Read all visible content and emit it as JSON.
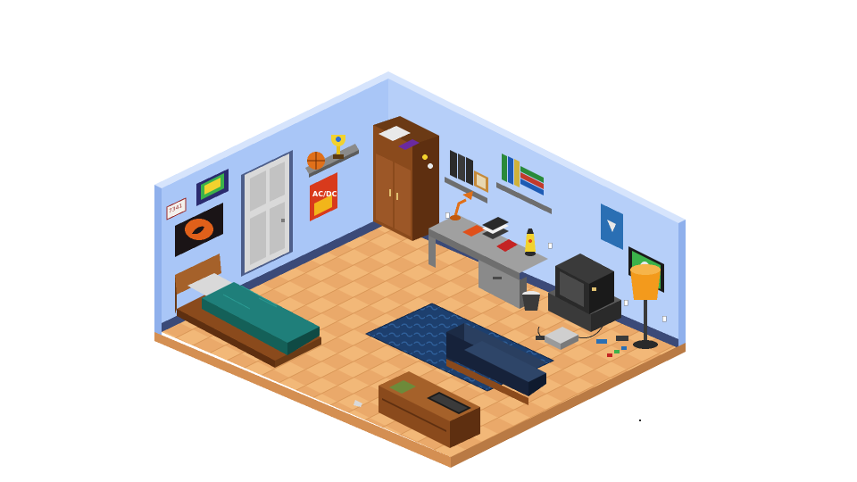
{
  "scene": {
    "kind": "isometric pixel-art bedroom",
    "colors": {
      "wall": "#a9c6f7",
      "wall_shade": "#8fb0ec",
      "wall_top": "#c9dbfb",
      "baseboard": "#3b4a78",
      "floor_light": "#f2b878",
      "floor_dark": "#dc9a5c",
      "floor_edge": "#c98a52",
      "wood": "#8a4a1c",
      "wood_dark": "#5e2f10",
      "bedding": "#1f7f7a",
      "rug": "#1d3f6e",
      "sofa": "#1c2b45",
      "desk": "#8e8e8e",
      "lamp_shade": "#f39a1c"
    }
  },
  "wall_signs": {
    "license_plate": "7341",
    "rock_poster": "AC/DC"
  },
  "objects": [
    {
      "id": "bed",
      "icon": "bed-icon"
    },
    {
      "id": "door",
      "icon": "door-icon"
    },
    {
      "id": "wardrobe",
      "icon": "wardrobe-icon"
    },
    {
      "id": "desk",
      "icon": "desk-icon"
    },
    {
      "id": "crt-tv",
      "icon": "tv-icon"
    },
    {
      "id": "sofa",
      "icon": "sofa-icon"
    },
    {
      "id": "coffee-chest",
      "icon": "chest-icon"
    },
    {
      "id": "floor-lamp",
      "icon": "lamp-icon"
    },
    {
      "id": "lava-lamp",
      "icon": "lava-lamp-icon"
    },
    {
      "id": "game-console",
      "icon": "console-icon"
    },
    {
      "id": "trophy",
      "icon": "trophy-icon"
    },
    {
      "id": "basketball",
      "icon": "ball-icon"
    }
  ]
}
